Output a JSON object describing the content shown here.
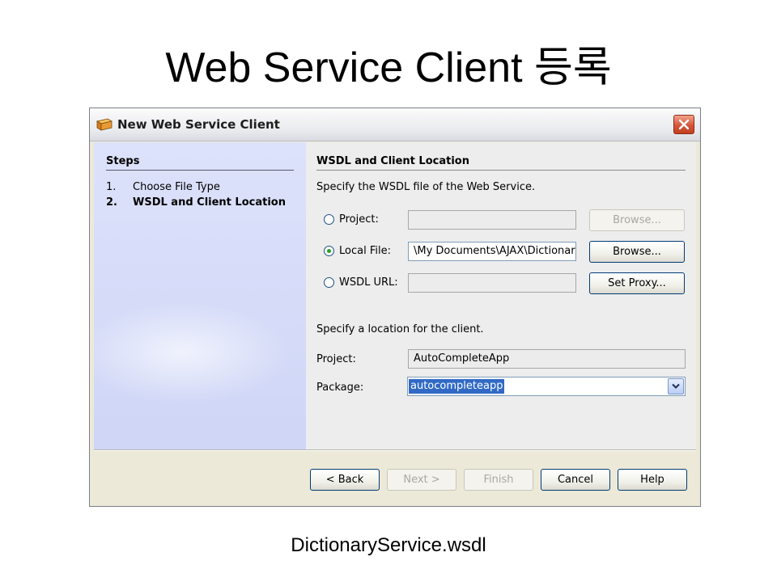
{
  "slide": {
    "title": "Web Service Client 등록",
    "caption": "DictionaryService.wsdl"
  },
  "dialog": {
    "title": "New Web Service Client",
    "steps": {
      "title": "Steps",
      "items": [
        {
          "num": "1.",
          "label": "Choose File Type"
        },
        {
          "num": "2.",
          "label": "WSDL and Client Location"
        }
      ]
    },
    "content": {
      "section_title": "WSDL and Client Location",
      "wsdl_prompt": "Specify the WSDL file of the Web Service.",
      "project_label": "Project:",
      "project_value": "",
      "local_file_label": "Local File:",
      "local_file_value": "\\My Documents\\AJAX\\Dictionar",
      "wsdl_url_label": "WSDL URL:",
      "wsdl_url_value": "",
      "selected_source": "Local File",
      "browse_disabled_label": "Browse...",
      "browse_label": "Browse...",
      "set_proxy_label": "Set Proxy...",
      "location_prompt": "Specify a location for the client.",
      "client_project_label": "Project:",
      "client_project_value": "AutoCompleteApp",
      "package_label": "Package:",
      "package_value": "autocompleteapp"
    },
    "buttons": {
      "back": "< Back",
      "next": "Next >",
      "finish": "Finish",
      "cancel": "Cancel",
      "help": "Help"
    }
  }
}
